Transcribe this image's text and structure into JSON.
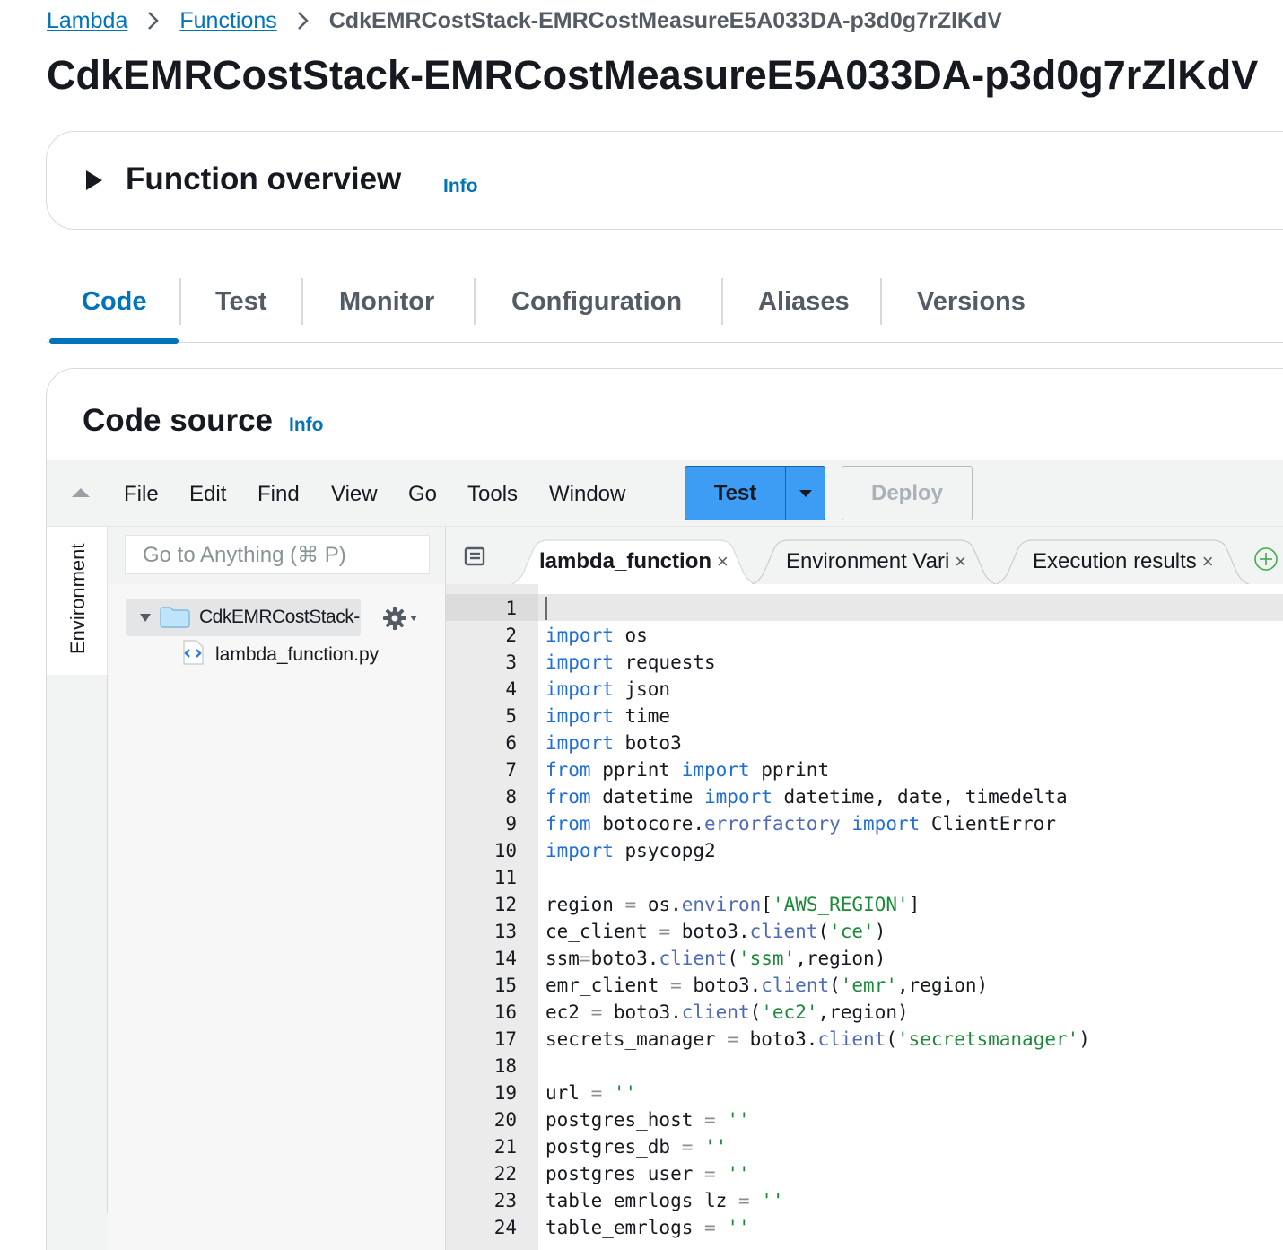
{
  "breadcrumb": {
    "items": [
      "Lambda",
      "Functions"
    ],
    "current": "CdkEMRCostStack-EMRCostMeasureE5A033DA-p3d0g7rZlKdV"
  },
  "page_title": "CdkEMRCostStack-EMRCostMeasureE5A033DA-p3d0g7rZlKdV",
  "overview": {
    "title": "Function overview",
    "info": "Info"
  },
  "tabs": [
    {
      "label": "Code",
      "active": true
    },
    {
      "label": "Test"
    },
    {
      "label": "Monitor"
    },
    {
      "label": "Configuration"
    },
    {
      "label": "Aliases"
    },
    {
      "label": "Versions"
    }
  ],
  "code_source": {
    "title": "Code source",
    "info": "Info"
  },
  "ide": {
    "menu": [
      "File",
      "Edit",
      "Find",
      "View",
      "Go",
      "Tools",
      "Window"
    ],
    "test_button": "Test",
    "deploy_button": "Deploy",
    "goto_placeholder": "Go to Anything (⌘ P)",
    "environment_label": "Environment",
    "tree": {
      "folder": "CdkEMRCostStack-E",
      "file": "lambda_function.py"
    },
    "editor_tabs": [
      {
        "label": "lambda_function",
        "active": true
      },
      {
        "label": "Environment Vari"
      },
      {
        "label": "Execution results"
      }
    ],
    "close_glyph": "×"
  },
  "code": {
    "line_numbers": [
      "1",
      "2",
      "3",
      "4",
      "5",
      "6",
      "7",
      "8",
      "9",
      "10",
      "11",
      "12",
      "13",
      "14",
      "15",
      "16",
      "17",
      "18",
      "19",
      "20",
      "21",
      "22",
      "23",
      "24"
    ],
    "lines": [
      "",
      "import os",
      "import requests",
      "import json",
      "import time",
      "import boto3",
      "from pprint import pprint",
      "from datetime import datetime, date, timedelta",
      "from botocore.errorfactory import ClientError",
      "import psycopg2",
      "",
      "region = os.environ['AWS_REGION']",
      "ce_client = boto3.client('ce')",
      "ssm=boto3.client('ssm',region)",
      "emr_client = boto3.client('emr',region)",
      "ec2 = boto3.client('ec2',region)",
      "secrets_manager = boto3.client('secretsmanager')",
      "",
      "url = ''",
      "postgres_host = ''",
      "postgres_db = ''",
      "postgres_user = ''",
      "table_emrlogs_lz = ''",
      "table_emrlogs = ''"
    ]
  },
  "colors": {
    "link": "#0073bb",
    "test_button": "#3d9cf4",
    "keyword": "#1f6fd6",
    "string": "#1d8a3a"
  }
}
